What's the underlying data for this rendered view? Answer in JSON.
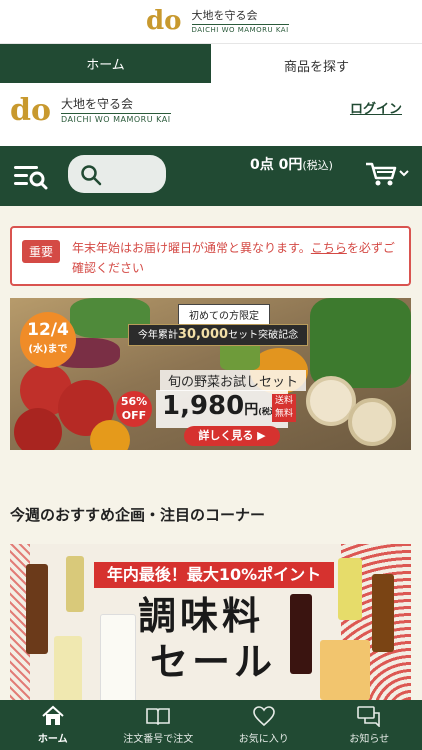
{
  "app_header": {
    "logo_letters": "do",
    "logo_jp": "大地を守る会",
    "logo_en": "DAICHI WO MAMORU KAI"
  },
  "tabs": [
    {
      "label": "ホーム",
      "active": true
    },
    {
      "label": "商品を探す",
      "active": false
    }
  ],
  "site_header": {
    "logo_letters": "do",
    "logo_jp": "大地を守る会",
    "logo_en": "DAICHI WO MAMORU KAI",
    "login_label": "ログイン"
  },
  "cart": {
    "points": "0点",
    "amount": "0円",
    "tax_note": "(税込)",
    "icon": "cart-icon"
  },
  "search": {
    "icon": "search-icon"
  },
  "menu": {
    "icon": "menu-search-icon"
  },
  "notice": {
    "badge": "重要",
    "text": "年末年始はお届け曜日が通常と異なります。",
    "link": "こちら",
    "text_after": "を必ずご確認ください"
  },
  "trial_banner": {
    "date": "12/4",
    "date_sub": "(水)まで",
    "limit_tag": "初めての方限定",
    "record_prefix": "今年累計",
    "record_value": "30,000",
    "record_suffix": "セット突破記念",
    "title": "旬の野菜お試しセット",
    "discount_pct": "56%",
    "discount_label": "OFF",
    "price": "1,980",
    "price_unit": "円",
    "price_tax": "(税込)",
    "shipping": "送料無料",
    "button": "詳しく見る"
  },
  "section": {
    "title": "今週のおすすめ企画・注目のコーナー"
  },
  "sale_banner": {
    "ribbon": "年内最後！最大10%ポイント",
    "line1": "調味料",
    "line2": "セール"
  },
  "bottom_nav": [
    {
      "label": "ホーム",
      "icon": "home-icon",
      "active": true
    },
    {
      "label": "注文番号で注文",
      "icon": "book-icon",
      "active": false
    },
    {
      "label": "お気に入り",
      "icon": "heart-icon",
      "active": false
    },
    {
      "label": "お知らせ",
      "icon": "chat-icon",
      "active": false
    }
  ],
  "colors": {
    "brand_green": "#214a33",
    "accent_gold": "#c8992e",
    "alert_red": "#d44a45",
    "cream_bg": "#f6f3e8"
  }
}
